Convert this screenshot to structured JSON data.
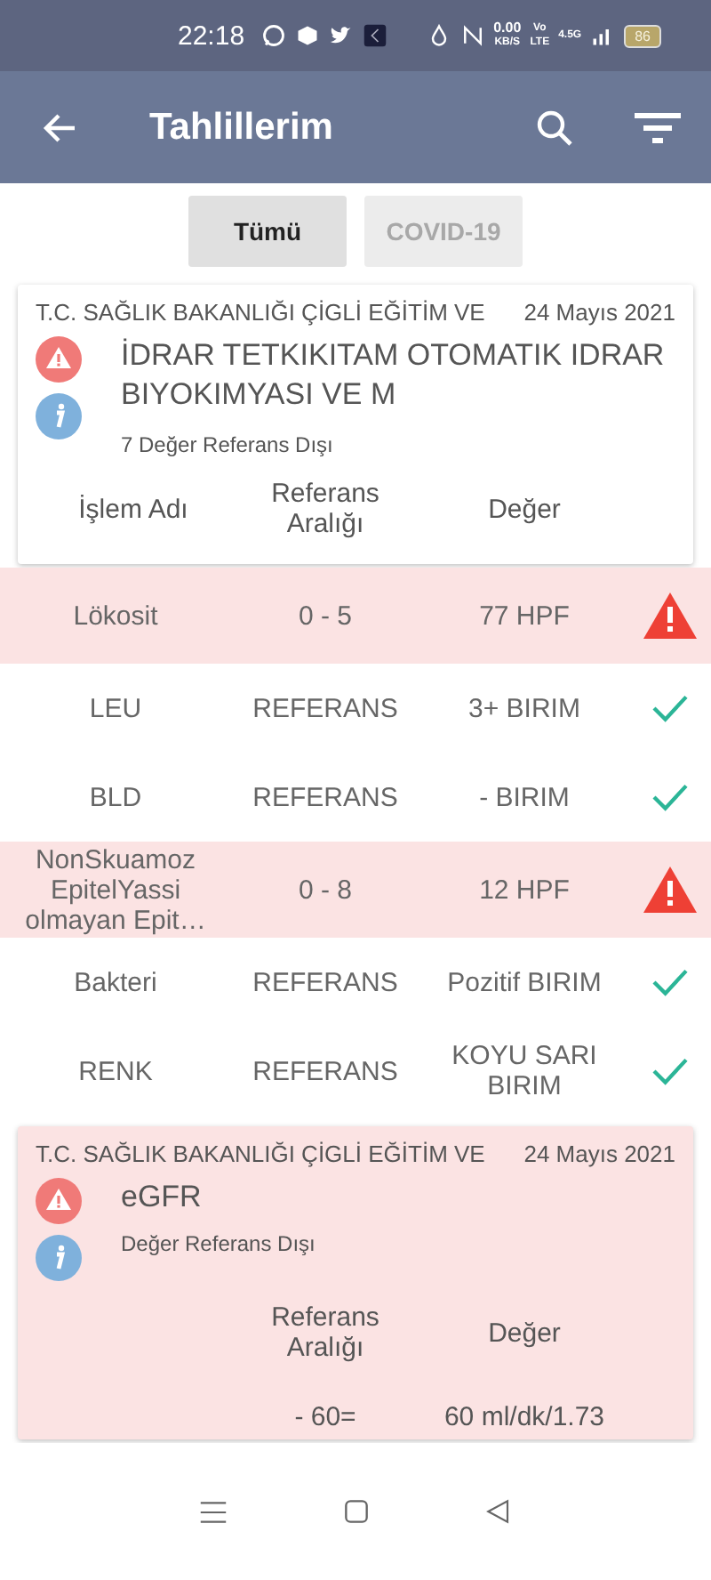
{
  "status_bar": {
    "time": "22:18",
    "speed": "0.00",
    "speed_unit": "KB/S",
    "volte": "Vo",
    "lte": "LTE",
    "network": "4.5G",
    "battery": "86"
  },
  "app_bar": {
    "title": "Tahlillerim"
  },
  "tabs": [
    {
      "label": "Tümü",
      "selected": true
    },
    {
      "label": "COVID-19",
      "selected": false
    }
  ],
  "results": [
    {
      "highlighted": false,
      "institution": "T.C. SAĞLIK BAKANLIĞI ÇİGLİ EĞİTİM VE",
      "date": "24 Mayıs 2021",
      "title": "İDRAR TETKIKITAM OTOMATIK IDRAR BIYOKIMYASI VE M",
      "summary": "7 Değer Referans Dışı",
      "columns": [
        "İşlem Adı",
        "Referans Aralığı",
        "Değer"
      ],
      "rows": [
        {
          "name": "Lökosit",
          "reference": "0 - 5",
          "value": "77 HPF",
          "out_of_range": true
        },
        {
          "name": "LEU",
          "reference": "REFERANS",
          "value": "3+ BIRIM",
          "out_of_range": false
        },
        {
          "name": "BLD",
          "reference": "REFERANS",
          "value": "- BIRIM",
          "out_of_range": false
        },
        {
          "name": "NonSkuamoz EpitelYassi olmayan Epit…",
          "reference": "0 - 8",
          "value": "12 HPF",
          "out_of_range": true
        },
        {
          "name": "Bakteri",
          "reference": "REFERANS",
          "value": "Pozitif BIRIM",
          "out_of_range": false
        },
        {
          "name": "RENK",
          "reference": "REFERANS",
          "value": "KOYU SARI BIRIM",
          "out_of_range": false
        }
      ]
    },
    {
      "highlighted": true,
      "institution": "T.C. SAĞLIK BAKANLIĞI ÇİGLİ EĞİTİM VE",
      "date": "24 Mayıs 2021",
      "title": "eGFR",
      "summary": "Değer Referans Dışı",
      "columns": [
        "Referans Aralığı",
        "Değer"
      ],
      "rows": [
        {
          "reference": "- 60=",
          "value": "60 ml/dk/1.73"
        }
      ]
    }
  ]
}
